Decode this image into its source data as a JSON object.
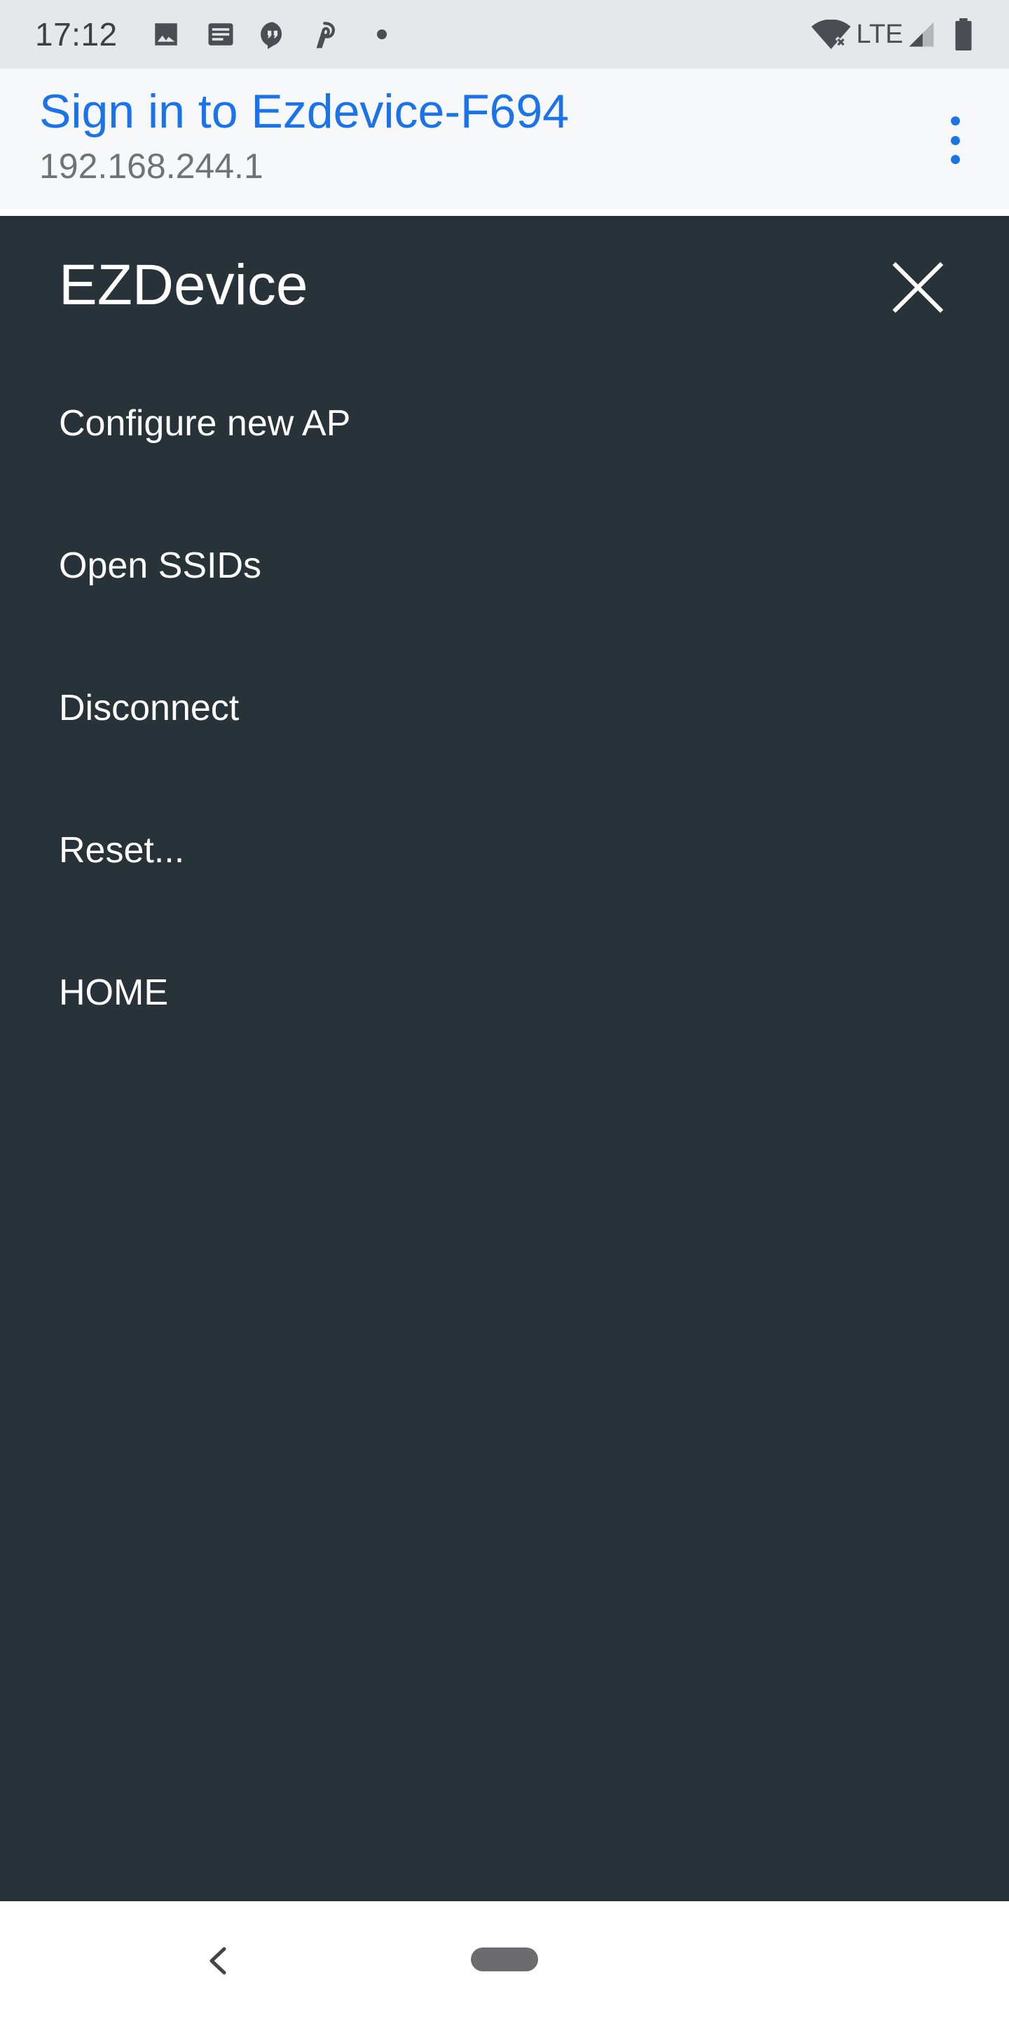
{
  "status_bar": {
    "time": "17:12",
    "network_label": "LTE",
    "icons": [
      "image-icon",
      "message-icon",
      "quote-icon",
      "pinterest-icon",
      "wifi-off-icon",
      "signal-icon",
      "battery-icon"
    ]
  },
  "header": {
    "title": "Sign in to Ezdevice-F694",
    "subtitle": "192.168.244.1",
    "accent_color": "#1a73e8"
  },
  "drawer": {
    "title": "EZDevice",
    "background": "#283239",
    "items": [
      {
        "label": "Configure new AP"
      },
      {
        "label": "Open SSIDs"
      },
      {
        "label": "Disconnect"
      },
      {
        "label": "Reset..."
      },
      {
        "label": "HOME"
      }
    ]
  },
  "nav_bar": {
    "icons": [
      "back-icon",
      "home-pill-icon"
    ]
  }
}
